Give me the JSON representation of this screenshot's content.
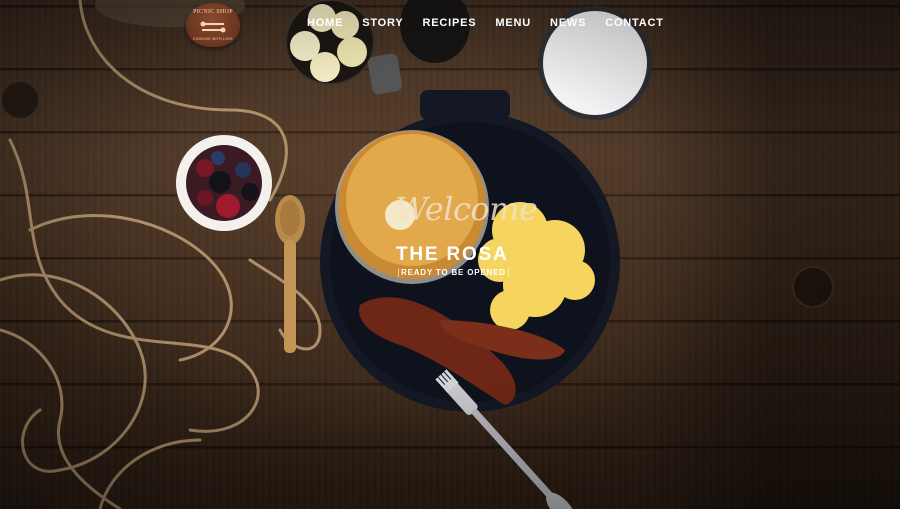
{
  "logo": {
    "name": "PICNIC SHOP",
    "tagline": "COOKING WITH LOVE"
  },
  "nav": {
    "items": [
      "HOME",
      "STORY",
      "RECIPES",
      "MENU",
      "NEWS",
      "CONTACT"
    ]
  },
  "hero": {
    "script": "Welcome",
    "title": "THE ROSA",
    "subtitle": "READY TO BE OPENED"
  }
}
